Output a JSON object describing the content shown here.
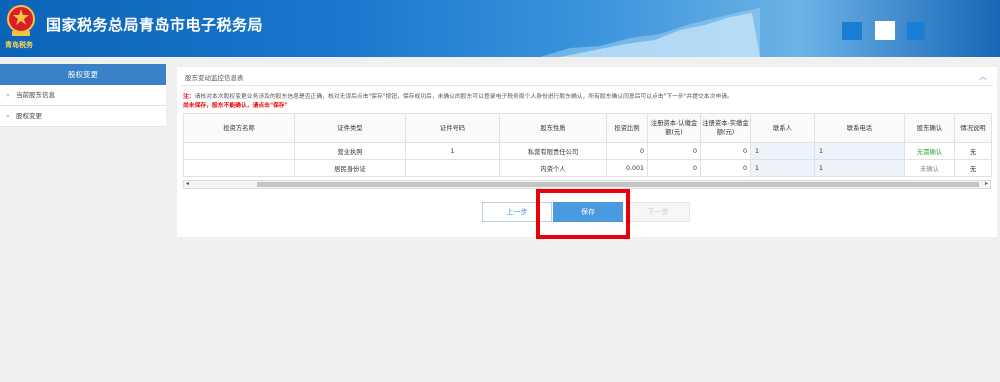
{
  "header": {
    "title": "国家税务总局青岛市电子税务局",
    "logo_text": "青岛税务"
  },
  "sidebar": {
    "heading": "股权变更",
    "items": [
      {
        "label": "当前股东信息"
      },
      {
        "label": "股权变更"
      }
    ]
  },
  "panel": {
    "title": "股东变动监控信息表",
    "note1_prefix": "注：",
    "note1_text": "请核对本次股权变更业务涉及的股东信息是否正确，核对无误后点击\"保存\"按钮，保存成功后，未确认的股东可以登录电子税务局个人身份进行股东确认，所有股东确认同意后可以点击\"下一步\"并提交本次申请。",
    "note2": "尚未保存，股东不能确认，请点击\"保存\""
  },
  "table": {
    "headers": [
      "投资方名称",
      "证件类型",
      "证件号码",
      "股东性质",
      "投资比例",
      "注册资本-认缴金额(元)",
      "注册资本-实缴金额(元)",
      "联系人",
      "联系电话",
      "股东确认",
      "情况说明"
    ],
    "rows": [
      {
        "name": "",
        "id_type": "营业执照",
        "id_no": "1",
        "nature": "私营有限责任公司",
        "ratio": "0",
        "subscribed": "0",
        "paid": "0",
        "contact": "1",
        "phone": "1",
        "confirm": "无需确认",
        "remark": "无"
      },
      {
        "name": "",
        "id_type": "居民身份证",
        "id_no": "",
        "nature": "内资个人",
        "ratio": "0.001",
        "subscribed": "0",
        "paid": "0",
        "contact": "1",
        "phone": "1",
        "confirm": "未确认",
        "remark": "无"
      }
    ]
  },
  "buttons": {
    "prev": "上一步",
    "save": "保存",
    "next": "下一步"
  },
  "colors": {
    "header_blue": "#0b64b8",
    "accent": "#4a9ae0",
    "highlight": "#e8000b",
    "confirm_ok": "#2eaa3a"
  },
  "icons": [
    "tax-emblem-icon",
    "collapse-up-icon",
    "scroll-left-icon",
    "scroll-right-icon",
    "bullet-icon"
  ]
}
